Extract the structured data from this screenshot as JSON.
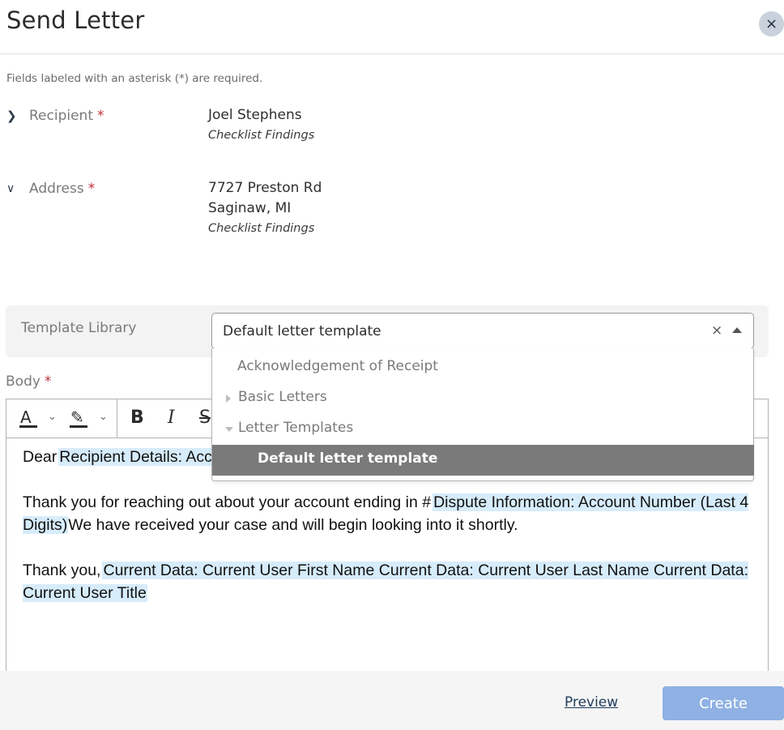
{
  "dialog": {
    "title": "Send Letter",
    "close_icon": "×",
    "required_note": "Fields labeled with an asterisk (*) are required."
  },
  "fields": {
    "recipient": {
      "label": "Recipient",
      "asterisk": "*",
      "expanded": false,
      "value": "Joel Stephens",
      "source": "Checklist Findings"
    },
    "address": {
      "label": "Address",
      "asterisk": "*",
      "expanded": true,
      "line1": "7727 Preston Rd",
      "line2": "Saginaw, MI",
      "source": "Checklist Findings"
    }
  },
  "template_library": {
    "label": "Template Library",
    "selected": "Default letter template",
    "clear_icon": "×",
    "options": [
      {
        "label": "Acknowledgement of Receipt",
        "type": "item"
      },
      {
        "label": "Basic Letters",
        "type": "group",
        "expanded": false
      },
      {
        "label": "Letter Templates",
        "type": "group",
        "expanded": true
      },
      {
        "label": "Default letter template",
        "type": "item",
        "selected": true
      }
    ]
  },
  "body": {
    "label": "Body",
    "asterisk": "*",
    "toolbar": {
      "font_color": "A",
      "bold": "B",
      "italic": "I",
      "strike": "S",
      "chevron": "⌄"
    },
    "content": {
      "p1_text": "Dear",
      "p1_tag": "Recipient Details: Acc",
      "p2_text1": "Thank you for reaching out about your account ending in #",
      "p2_tag": "Dispute Information: Account Number (Last 4 Digits)",
      "p2_text2": "We have received your case and will begin looking into it shortly.",
      "p3_text": "Thank you,",
      "p3_tag": "Current Data: Current User First Name Current Data: Current User Last Name Current Data: Current User Title"
    }
  },
  "footer": {
    "preview_label": "Preview",
    "create_label": "Create"
  },
  "colors": {
    "accent": "#8fb1e3",
    "tag_bg": "#d7ecfb",
    "required": "#c0303a",
    "selected_option": "#7a7a7a"
  }
}
